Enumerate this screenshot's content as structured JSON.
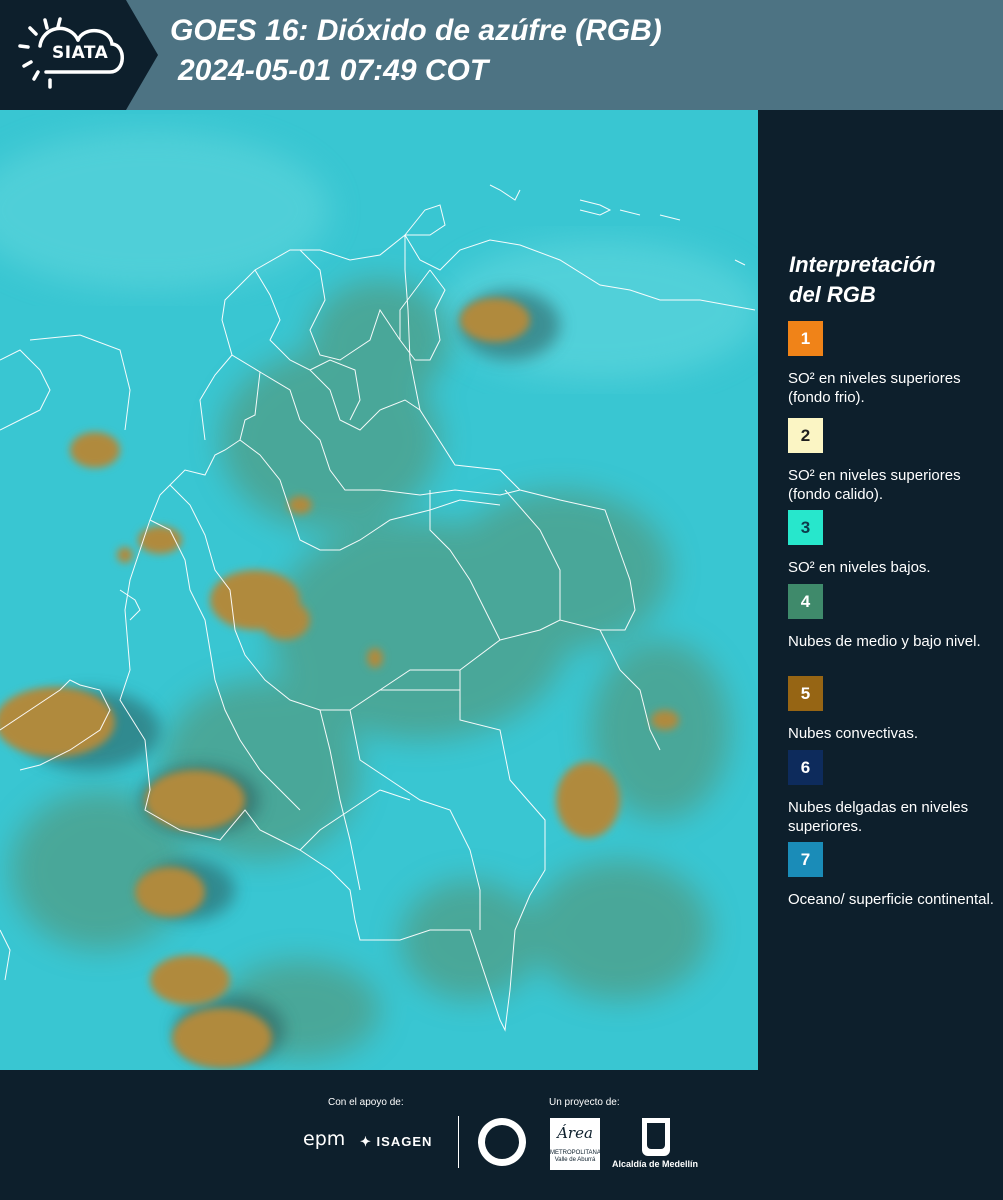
{
  "header": {
    "logo_text": "SIATA",
    "title_line1": "GOES 16: Dióxido de azúfre (RGB)",
    "title_line2": "2024-05-01 07:49 COT"
  },
  "map": {
    "description_icon": "satellite-rgb-image",
    "colors": {
      "background": "#39c6d2",
      "low_cloud": "#4a9a80",
      "convective": "#b08a3e",
      "borders": "#ffffff"
    }
  },
  "legend": {
    "title_line1": "Interpretación",
    "title_line2": "del RGB",
    "items": [
      {
        "number": "1",
        "color": "#f08318",
        "text": "SO² en niveles superiores (fondo frio)."
      },
      {
        "number": "2",
        "color": "#fbf5c4",
        "text": "SO² en niveles superiores (fondo calido)."
      },
      {
        "number": "3",
        "color": "#27e7cc",
        "text": "SO² en niveles bajos."
      },
      {
        "number": "4",
        "color": "#3f8a6b",
        "text": "Nubes de medio y bajo nivel."
      },
      {
        "number": "5",
        "color": "#966514",
        "text": "Nubes convectivas."
      },
      {
        "number": "6",
        "color": "#0d2b5c",
        "text": "Nubes delgadas en niveles superiores."
      },
      {
        "number": "7",
        "color": "#1a8cb8",
        "text": "Oceano/ superficie continental."
      }
    ]
  },
  "footer": {
    "support_label": "Con el apoyo de:",
    "project_label": "Un proyecto de:",
    "epm": "epm",
    "isagen": "ISAGEN",
    "area_word": "Área",
    "area_sub": "METROPOLITANA Valle de Aburrá",
    "medellin": "Alcaldía de Medellín"
  }
}
